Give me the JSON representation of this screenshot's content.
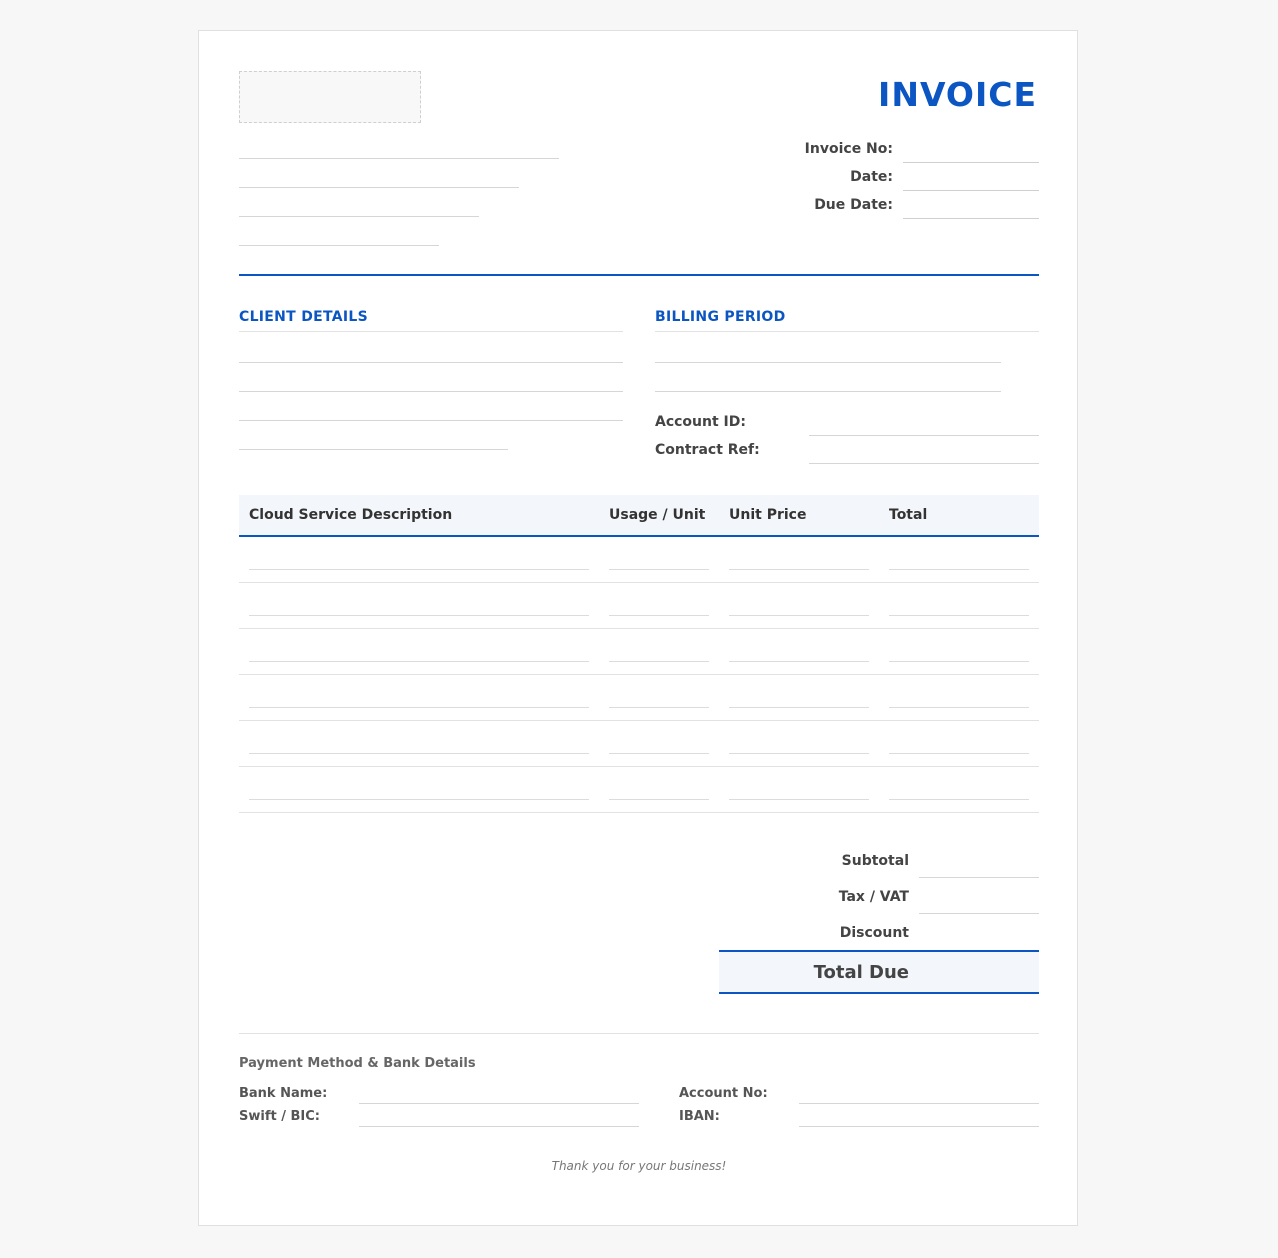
{
  "header": {
    "title": "INVOICE",
    "meta": [
      {
        "label": "Invoice No:"
      },
      {
        "label": "Date:"
      },
      {
        "label": "Due Date:"
      }
    ]
  },
  "client": {
    "title": "CLIENT DETAILS"
  },
  "billing": {
    "title": "BILLING PERIOD",
    "account_id_label": "Account ID:",
    "contract_ref_label": "Contract Ref:"
  },
  "table": {
    "columns": [
      "Cloud Service Description",
      "Usage / Unit",
      "Unit Price",
      "Total"
    ],
    "row_count": 6
  },
  "totals": {
    "subtotal_label": "Subtotal",
    "tax_label": "Tax / VAT",
    "discount_label": "Discount",
    "total_due_label": "Total Due"
  },
  "payment": {
    "title": "Payment Method & Bank Details",
    "bank_name_label": "Bank Name:",
    "swift_label": "Swift / BIC:",
    "account_no_label": "Account No:",
    "iban_label": "IBAN:"
  },
  "footer": {
    "thanks": "Thank you for your business!"
  },
  "colors": {
    "accent": "#0b56c2",
    "header_bg": "#f3f6fa"
  }
}
